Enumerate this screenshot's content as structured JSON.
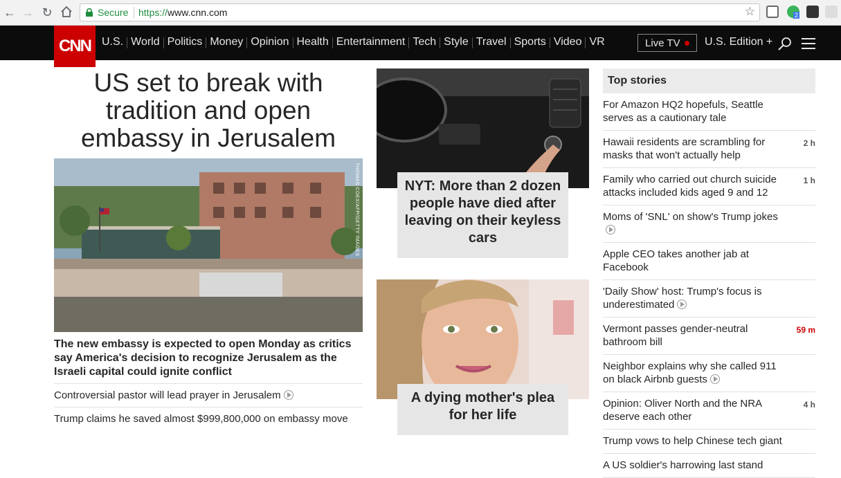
{
  "browser": {
    "secure_label": "Secure",
    "url_scheme": "https://",
    "url_host": "www.cnn.com",
    "ext_badge": "2"
  },
  "header": {
    "logo": "CNN",
    "nav": [
      "U.S.",
      "World",
      "Politics",
      "Money",
      "Opinion",
      "Health",
      "Entertainment",
      "Tech",
      "Style",
      "Travel",
      "Sports",
      "Video",
      "VR"
    ],
    "live_tv": "Live TV",
    "edition": "U.S. Edition +"
  },
  "lead": {
    "headline": "US set to break with tradition and open embassy in Jerusalem",
    "photo_credit": "THOMAS COEX/AFP/GETTY IMAGES",
    "lede": "The new embassy is expected to open Monday as critics say America's decision to recognize Jerusalem as the Israeli capital could ignite conflict",
    "related": [
      "Controversial pastor will lead prayer in Jerusalem",
      "Trump claims he saved almost $999,800,000 on embassy move"
    ]
  },
  "cards": [
    {
      "title": "NYT: More than 2 dozen people have died after leaving on their keyless cars"
    },
    {
      "title": "A dying mother's plea for her life"
    }
  ],
  "top_stories": {
    "title": "Top stories",
    "items": [
      {
        "text": "For Amazon HQ2 hopefuls, Seattle serves as a cautionary tale",
        "time": "",
        "video": false
      },
      {
        "text": "Hawaii residents are scrambling for masks that won't actually help",
        "time": "2 h",
        "video": false
      },
      {
        "text": "Family who carried out church suicide attacks included kids aged 9 and 12",
        "time": "1 h",
        "video": false
      },
      {
        "text": "Moms of 'SNL' on show's Trump jokes",
        "time": "",
        "video": true
      },
      {
        "text": "Apple CEO takes another jab at Facebook",
        "time": "",
        "video": false
      },
      {
        "text": "'Daily Show' host: Trump's focus is underestimated",
        "time": "",
        "video": true
      },
      {
        "text": "Vermont passes gender-neutral bathroom bill",
        "time": "59 m",
        "video": false,
        "red": true
      },
      {
        "text": "Neighbor explains why she called 911 on black Airbnb guests",
        "time": "",
        "video": true
      },
      {
        "text": "Opinion: Oliver North and the NRA deserve each other",
        "time": "4 h",
        "video": false
      },
      {
        "text": "Trump vows to help Chinese tech giant",
        "time": "",
        "video": false
      },
      {
        "text": "A US soldier's harrowing last stand",
        "time": "",
        "video": false
      }
    ]
  },
  "colors": {
    "cnn_red": "#cc0000",
    "header_bg": "#0c0c0c",
    "secure_green": "#1e8e3e"
  }
}
